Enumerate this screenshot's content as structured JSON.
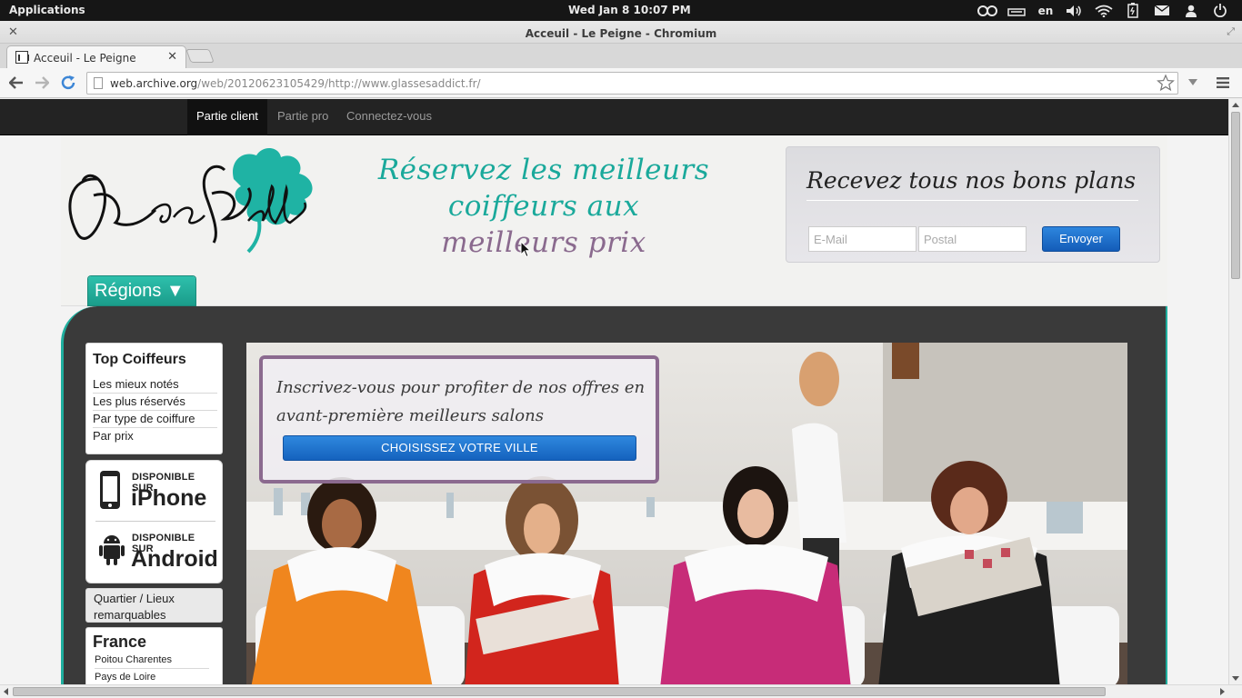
{
  "desktop": {
    "applications_label": "Applications",
    "clock": "Wed Jan  8 10:07 PM",
    "language": "en"
  },
  "window": {
    "title": "Acceuil - Le Peigne - Chromium"
  },
  "browser": {
    "tab_title": "Acceuil - Le Peigne",
    "url_host": "web.archive.org",
    "url_path": "/web/20120623105429/http://www.glassesaddict.fr/"
  },
  "site": {
    "nav": {
      "client": "Partie client",
      "pro": "Partie pro",
      "login": "Connectez-vous"
    },
    "tagline_part1": "Réservez les meilleurs coiffeurs aux",
    "tagline_part2": "meilleurs prix",
    "newsletter": {
      "title": "Recevez tous nos bons plans",
      "email_placeholder": "E-Mail",
      "postal_placeholder": "Postal",
      "send_label": "Envoyer"
    },
    "regions_label": "Régions ▼",
    "top_coiffeurs": {
      "title": "Top Coiffeurs",
      "links": [
        "Les mieux notés",
        "Les plus réservés",
        "Par type de coiffure",
        "Par prix"
      ]
    },
    "apps": {
      "iphone_small": "DISPONIBLE SUR",
      "iphone_big": "iPhone",
      "android_small": "DISPONIBLE SUR",
      "android_big": "Android"
    },
    "quartier_label": "Quartier / Lieux remarquables",
    "france": {
      "title": "France",
      "regions": [
        "Poitou Charentes",
        "Pays de Loire"
      ]
    },
    "promo": {
      "text": "Inscrivez-vous pour profiter de nos offres en avant-première meilleurs salons",
      "button": "CHOISISSEZ VOTRE VILLE"
    }
  },
  "colors": {
    "teal": "#1aa99b",
    "mauve": "#8a6a8e",
    "button_blue": "#1a6cc8",
    "nav_dark": "#232323"
  }
}
